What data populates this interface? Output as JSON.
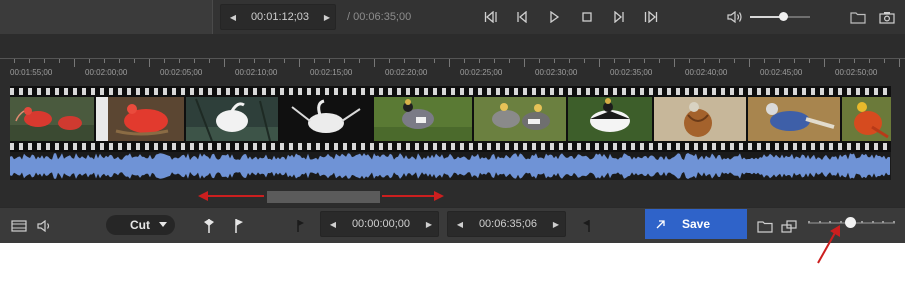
{
  "player": {
    "current_time": "00:01:12;03",
    "total_duration": "/ 00:06:35;00",
    "volume_level": 0.55
  },
  "ruler": {
    "labels": [
      "00:01:55;00",
      "00:02:00;00",
      "00:02:05;00",
      "00:02:10;00",
      "00:02:15;00",
      "00:02:20;00",
      "00:02:25;00",
      "00:02:30;00",
      "00:02:35;00",
      "00:02:40;00",
      "00:02:45;00",
      "00:02:50;00"
    ]
  },
  "filmstrip": {
    "frames": [
      "scarlet ibis",
      "scarlet ibis",
      "white egret",
      "white egret",
      "crowned crane",
      "crowned crane",
      "crowned crane",
      "pheasant",
      "blue pheasant",
      "golden pheasant"
    ]
  },
  "edit": {
    "mode_label": "Cut",
    "start_time": "00:00:00;00",
    "end_time": "00:06:35;06",
    "save_label": "Save",
    "zoom_level": 0.48
  },
  "colors": {
    "accent": "#2f63c9",
    "annotation": "#cc1f1f",
    "waveform": "#6f93d6"
  }
}
